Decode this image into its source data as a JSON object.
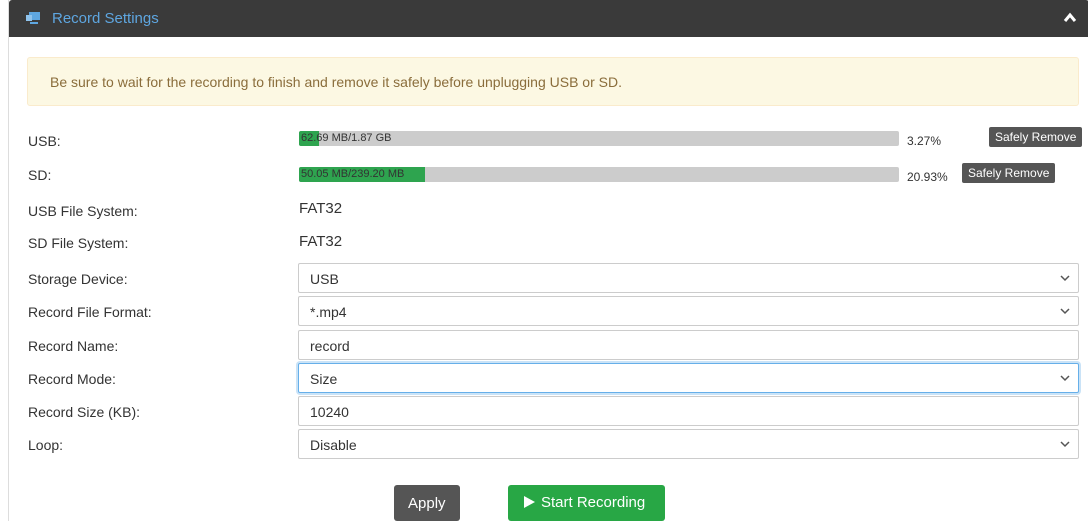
{
  "panel": {
    "title": "Record Settings",
    "icon": "monitor-icon",
    "collapse_icon": "chevron-up-icon"
  },
  "alert": {
    "text": "Be sure to wait for the recording to finish and remove it safely before unplugging USB or SD."
  },
  "usb": {
    "label": "USB:",
    "usage_text": "62.69 MB/1.87 GB",
    "percent_text": "3.27%",
    "fill_fraction": 0.0327,
    "remove_label": "Safely Remove"
  },
  "sd": {
    "label": "SD:",
    "usage_text": "50.05 MB/239.20 MB",
    "percent_text": "20.93%",
    "fill_fraction": 0.2093,
    "remove_label": "Safely Remove"
  },
  "usb_fs": {
    "label": "USB File System:",
    "value": "FAT32"
  },
  "sd_fs": {
    "label": "SD File System:",
    "value": "FAT32"
  },
  "storage_device": {
    "label": "Storage Device:",
    "value": "USB"
  },
  "file_format": {
    "label": "Record File Format:",
    "value": "*.mp4"
  },
  "record_name": {
    "label": "Record Name:",
    "value": "record"
  },
  "record_mode": {
    "label": "Record Mode:",
    "value": "Size"
  },
  "record_size": {
    "label": "Record Size (KB):",
    "value": "10240"
  },
  "loop": {
    "label": "Loop:",
    "value": "Disable"
  },
  "actions": {
    "apply_label": "Apply",
    "start_label": "Start Recording"
  },
  "colors": {
    "header_bg": "#3a3a3a",
    "title": "#5ea6e0",
    "progress_fill": "#2ea44f",
    "alert_bg": "#fcf8e3",
    "alert_text": "#8a6d3b",
    "start_button": "#28a745",
    "dark_button": "#555555"
  }
}
